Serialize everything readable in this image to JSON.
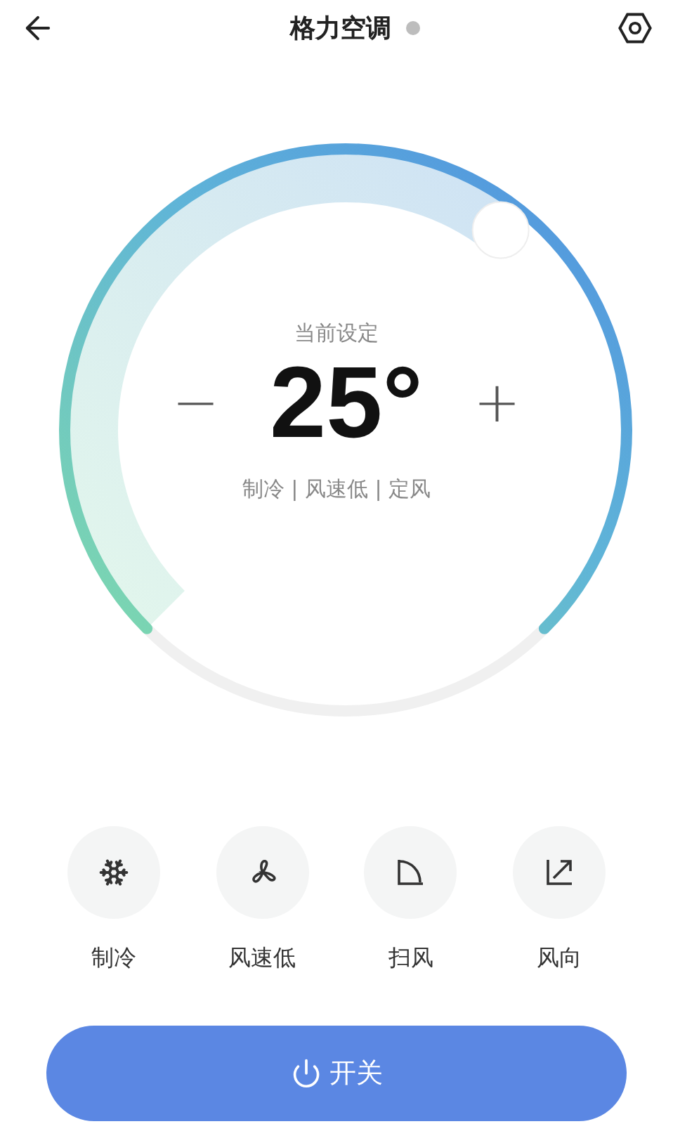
{
  "header": {
    "title": "格力空调",
    "online": false
  },
  "dial": {
    "caption": "当前设定",
    "temperature": "25°",
    "minus": "−",
    "plus": "+",
    "status": "制冷 | 风速低 | 定风"
  },
  "modes": [
    {
      "kind": "cool",
      "label": "制冷"
    },
    {
      "kind": "fan",
      "label": "风速低"
    },
    {
      "kind": "sweep",
      "label": "扫风"
    },
    {
      "kind": "direction",
      "label": "风向"
    }
  ],
  "power_button": {
    "label": "开关"
  }
}
